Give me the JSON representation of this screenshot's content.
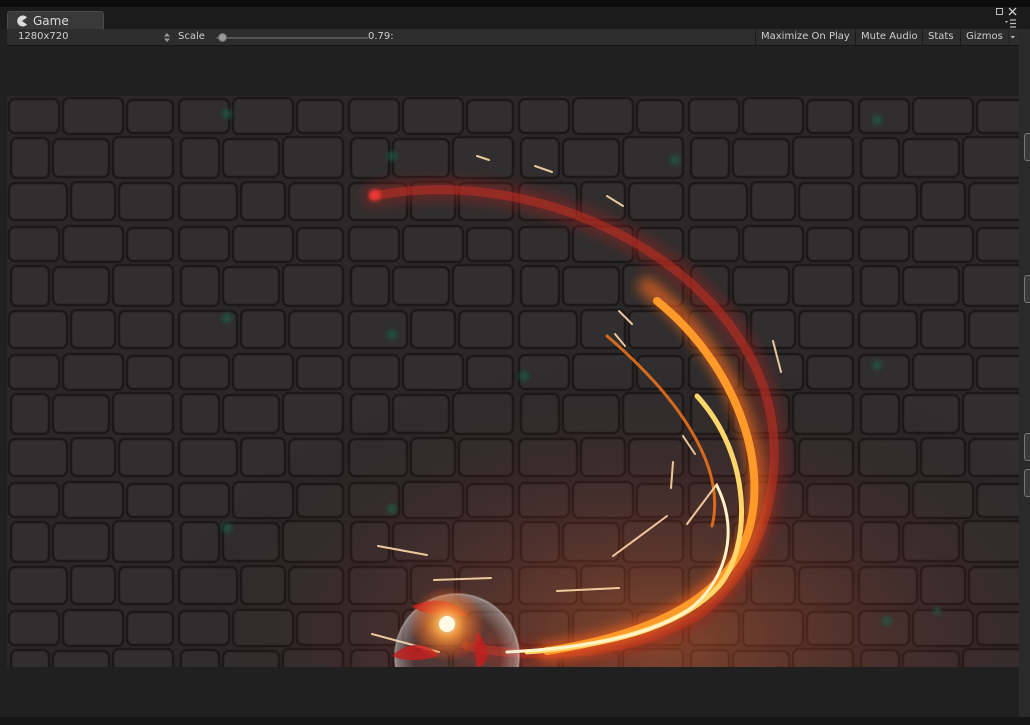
{
  "tab": {
    "title": "Game",
    "icon": "pacman-icon"
  },
  "toolbar": {
    "resolution": "1280x720",
    "scale_label": "Scale",
    "scale_value": "0.79:",
    "scale_fraction": 0.0,
    "maximize_on_play": "Maximize On Play",
    "mute_audio": "Mute Audio",
    "stats": "Stats",
    "gizmos": "Gizmos"
  },
  "colors": {
    "background": "#202020",
    "toolbar": "#2d2d2d",
    "wall": "#2f2c2d",
    "fire_core": "#fff2a0",
    "fire_mid": "#ff7a1a",
    "fire_outer": "#c8201a"
  },
  "icons": [
    "pacman-icon",
    "dropdown-arrows-icon",
    "maximize-icon",
    "close-icon",
    "panel-menu-icon",
    "gizmos-dropdown-icon"
  ]
}
